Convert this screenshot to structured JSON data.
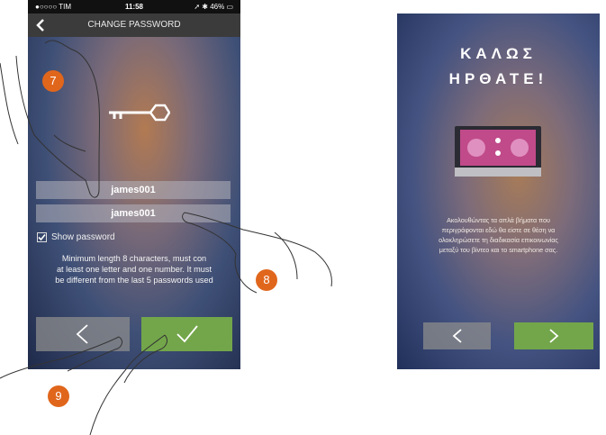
{
  "left_screen": {
    "status": {
      "carrier": "●○○○○ TIM",
      "time": "11:58",
      "right": "46%"
    },
    "title": "CHANGE PASSWORD",
    "password_value": "james001",
    "confirm_value": "james001",
    "show_password_label": "Show password",
    "help_lines": [
      "Minimum length 8 characters, must con",
      "at least one letter and one number. It must",
      "be different from the last 5 passwords used"
    ],
    "back_button_icon": "chevron-left-icon",
    "confirm_button_icon": "checkmark-icon",
    "key_icon": "key-icon",
    "colors": {
      "green": "#73a64a",
      "grey": "#8c8c8c",
      "marker": "#e0661c"
    }
  },
  "right_screen": {
    "welcome_line1": "ΚΑΛΩΣ",
    "welcome_line2": "ΗΡΘΑΤΕ!",
    "description_lines": [
      "Ακολουθώντας τα απλά βήματα που",
      "περιγράφονται εδώ θα είστε σε θέση να",
      "ολοκληρώσετε τη διαδικασία επικοινωνίας",
      "μεταξύ του βίντεο και το smartphone σας."
    ],
    "prev_icon": "chevron-left-icon",
    "next_icon": "chevron-right-icon",
    "device_icon": "video-entry-device-icon"
  },
  "markers": {
    "m7": "7",
    "m8": "8",
    "m9": "9"
  }
}
